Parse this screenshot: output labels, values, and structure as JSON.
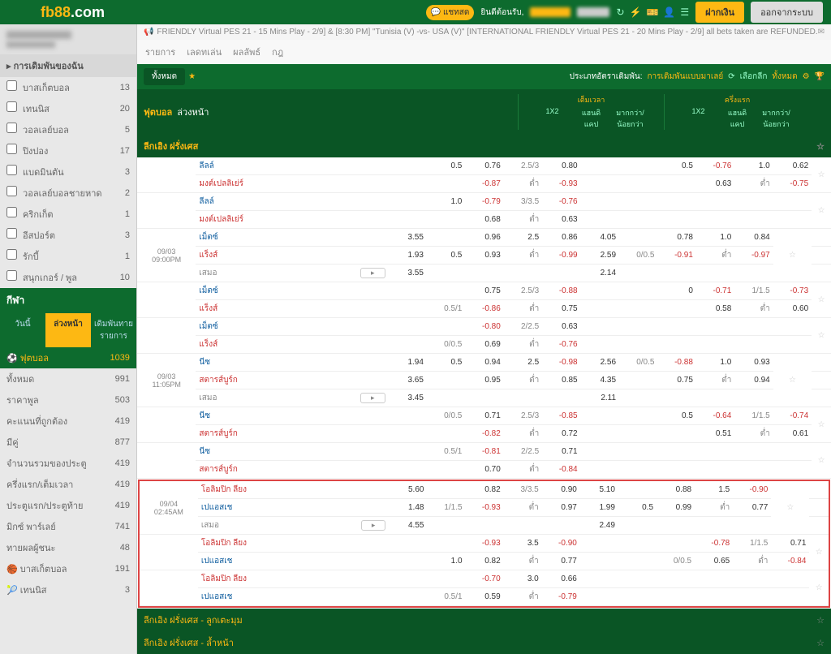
{
  "header": {
    "logo_main": "fb88",
    "logo_ext": ".com",
    "chat_label": "แชทสด",
    "welcome": "ยินดีต้อนรับ,",
    "deposit": "ฝากเงิน",
    "logout": "ออกจากระบบ"
  },
  "ticker": "FRIENDLY Virtual PES 21 - 15 Mins Play - 2/9] & [8:30 PM] \"Tunisia (V) -vs- USA (V)\" [INTERNATIONAL FRIENDLY Virtual PES 21 - 20 Mins Play - 2/9] all bets taken are REFUNDED.",
  "content_tabs": [
    "รายการ",
    "เลดทเล่น",
    "ผลลัพธ์",
    "กฎ"
  ],
  "sidebar": {
    "section_mybets": "การเดิมพันของฉัน",
    "mybets": [
      {
        "label": "บาสเก็ตบอล",
        "count": "13"
      },
      {
        "label": "เทนนิส",
        "count": "20"
      },
      {
        "label": "วอลเลย์บอล",
        "count": "5"
      },
      {
        "label": "ปิงปอง",
        "count": "17"
      },
      {
        "label": "แบดมินตัน",
        "count": "3"
      },
      {
        "label": "วอลเลย์บอลชายหาด",
        "count": "2"
      },
      {
        "label": "คริกเก็ต",
        "count": "1"
      },
      {
        "label": "อีสปอร์ต",
        "count": "3"
      },
      {
        "label": "รักบี้",
        "count": "1"
      },
      {
        "label": "สนุกเกอร์ / พูล",
        "count": "10"
      }
    ],
    "sport_header": "กีฬา",
    "sport_tabs": [
      "วันนี้",
      "ล่วงหน้า",
      "เดิมพันทาย\nรายการ"
    ],
    "sports": [
      {
        "label": "ฟุตบอล",
        "count": "1039",
        "icon": "⚽",
        "active": true
      },
      {
        "label": "ทั้งหมด",
        "count": "991"
      },
      {
        "label": "ราคาพูล",
        "count": "503"
      },
      {
        "label": "คะแนนที่ถูกต้อง",
        "count": "419"
      },
      {
        "label": "มีคู่",
        "count": "877"
      },
      {
        "label": "จำนวนรวมของประตู",
        "count": "419"
      },
      {
        "label": "ครึ่งแรก/เต็มเวลา",
        "count": "419"
      },
      {
        "label": "ประตูแรก/ประตูท้าย",
        "count": "419"
      },
      {
        "label": "มิกซ์ พาร์เลย์",
        "count": "741"
      },
      {
        "label": "ทายผลผู้ชนะ",
        "count": "48"
      },
      {
        "label": "บาสเก็ตบอล",
        "count": "191",
        "icon": "🏀"
      },
      {
        "label": "เทนนิส",
        "count": "3",
        "icon": "🎾"
      }
    ]
  },
  "filter": {
    "all": "ทั้งหมด",
    "label": "ประเภทอัตราเดิมพัน:",
    "type": "การเดิมพันแบบมาเลย์",
    "select": "เลือกลีก",
    "all2": "ทั้งหมด"
  },
  "title": {
    "main": "ฟุตบอล",
    "sub": "ล่วงหน้า",
    "fulltime": "เต็มเวลา",
    "firsthalf": "ครึ่งแรก",
    "cols": [
      "1X2",
      "แฮนดิแคป",
      "มากกว่า/น้อยกว่า",
      "1X2",
      "แฮนดิแคป",
      "มากกว่า/น้อยกว่า"
    ]
  },
  "league": "ลีกเอิง ฝรั่งเศส",
  "league_sub1": "ลีกเอิง ฝรั่งเศส - ลูกเตะมุม",
  "league_sub2": "ลีกเอิง ฝรั่งเศส - ล้ำหน้า",
  "matches": [
    {
      "rows": [
        {
          "team": "ลีลล์",
          "cls": "team",
          "o": [
            "",
            "0.5",
            "0.76",
            "2.5/3",
            "0.80",
            "",
            "",
            "0.5",
            "-0.76",
            "1.0",
            "0.62"
          ]
        },
        {
          "team": "มงต์เปลลิเย่ร์",
          "cls": "team away",
          "o": [
            "",
            "",
            "-0.87",
            "ต่ำ",
            "-0.93",
            "",
            "",
            "",
            "0.63",
            "ต่ำ",
            "-0.75"
          ]
        }
      ]
    },
    {
      "rows": [
        {
          "team": "ลีลล์",
          "cls": "team",
          "o": [
            "",
            "1.0",
            "-0.79",
            "3/3.5",
            "-0.76",
            "",
            "",
            "",
            "",
            "",
            ""
          ]
        },
        {
          "team": "มงต์เปลลิเย่ร์",
          "cls": "team away",
          "o": [
            "",
            "",
            "0.68",
            "ต่ำ",
            "0.63",
            "",
            "",
            "",
            "",
            "",
            ""
          ]
        }
      ]
    },
    {
      "date": "09/03",
      "time": "09:00PM",
      "rows": [
        {
          "team": "เม็ตซ์",
          "cls": "team",
          "o": [
            "3.55",
            "",
            "0.96",
            "2.5",
            "0.86",
            "4.05",
            "",
            "0.78",
            "1.0",
            "0.84"
          ]
        },
        {
          "team": "แร็งส์",
          "cls": "team away",
          "o": [
            "1.93",
            "0.5",
            "0.93",
            "ต่ำ",
            "-0.99",
            "2.59",
            "0/0.5",
            "-0.91",
            "ต่ำ",
            "-0.97"
          ]
        },
        {
          "team": "เสมอ",
          "cls": "team draw",
          "more": true,
          "o": [
            "3.55",
            "",
            "",
            "",
            "",
            "2.14",
            "",
            "",
            "",
            ""
          ]
        }
      ]
    },
    {
      "rows": [
        {
          "team": "เม็ตซ์",
          "cls": "team",
          "o": [
            "",
            "",
            "0.75",
            "2.5/3",
            "-0.88",
            "",
            "",
            "0",
            "-0.71",
            "1/1.5",
            "-0.73"
          ]
        },
        {
          "team": "แร็งส์",
          "cls": "team away",
          "o": [
            "",
            "0.5/1",
            "-0.86",
            "ต่ำ",
            "0.75",
            "",
            "",
            "",
            "0.58",
            "ต่ำ",
            "0.60"
          ]
        }
      ]
    },
    {
      "rows": [
        {
          "team": "เม็ตซ์",
          "cls": "team",
          "o": [
            "",
            "",
            "-0.80",
            "2/2.5",
            "0.63",
            "",
            "",
            "",
            "",
            "",
            ""
          ]
        },
        {
          "team": "แร็งส์",
          "cls": "team away",
          "o": [
            "",
            "0/0.5",
            "0.69",
            "ต่ำ",
            "-0.76",
            "",
            "",
            "",
            "",
            "",
            ""
          ]
        }
      ]
    },
    {
      "date": "09/03",
      "time": "11:05PM",
      "rows": [
        {
          "team": "นีซ",
          "cls": "team",
          "o": [
            "1.94",
            "0.5",
            "0.94",
            "2.5",
            "-0.98",
            "2.56",
            "0/0.5",
            "-0.88",
            "1.0",
            "0.93"
          ]
        },
        {
          "team": "สตารส์บูร์ก",
          "cls": "team away",
          "o": [
            "3.65",
            "",
            "0.95",
            "ต่ำ",
            "0.85",
            "4.35",
            "",
            "0.75",
            "ต่ำ",
            "0.94"
          ]
        },
        {
          "team": "เสมอ",
          "cls": "team draw",
          "more": true,
          "o": [
            "3.45",
            "",
            "",
            "",
            "",
            "2.11",
            "",
            "",
            "",
            ""
          ]
        }
      ]
    },
    {
      "rows": [
        {
          "team": "นีซ",
          "cls": "team",
          "o": [
            "",
            "0/0.5",
            "0.71",
            "2.5/3",
            "-0.85",
            "",
            "",
            "0.5",
            "-0.64",
            "1/1.5",
            "-0.74"
          ]
        },
        {
          "team": "สตารส์บูร์ก",
          "cls": "team away",
          "o": [
            "",
            "",
            "-0.82",
            "ต่ำ",
            "0.72",
            "",
            "",
            "",
            "0.51",
            "ต่ำ",
            "0.61"
          ]
        }
      ]
    },
    {
      "rows": [
        {
          "team": "นีซ",
          "cls": "team",
          "o": [
            "",
            "0.5/1",
            "-0.81",
            "2/2.5",
            "0.71",
            "",
            "",
            "",
            "",
            "",
            ""
          ]
        },
        {
          "team": "สตารส์บูร์ก",
          "cls": "team away",
          "o": [
            "",
            "",
            "0.70",
            "ต่ำ",
            "-0.84",
            "",
            "",
            "",
            "",
            "",
            ""
          ]
        }
      ]
    }
  ],
  "highlighted": [
    {
      "date": "09/04",
      "time": "02:45AM",
      "rows": [
        {
          "team": "โอลิมปิก ลียง",
          "cls": "team away",
          "o": [
            "5.60",
            "",
            "0.82",
            "3/3.5",
            "0.90",
            "5.10",
            "",
            "0.88",
            "1.5",
            "-0.90"
          ]
        },
        {
          "team": "เปแอสเช",
          "cls": "team",
          "o": [
            "1.48",
            "1/1.5",
            "-0.93",
            "ต่ำ",
            "0.97",
            "1.99",
            "0.5",
            "0.99",
            "ต่ำ",
            "0.77"
          ]
        },
        {
          "team": "เสมอ",
          "cls": "team draw",
          "more": true,
          "o": [
            "4.55",
            "",
            "",
            "",
            "",
            "2.49",
            "",
            "",
            "",
            ""
          ]
        }
      ]
    },
    {
      "rows": [
        {
          "team": "โอลิมปิก ลียง",
          "cls": "team away",
          "o": [
            "",
            "",
            "-0.93",
            "3.5",
            "-0.90",
            "",
            "",
            "",
            "-0.78",
            "1/1.5",
            "0.71"
          ]
        },
        {
          "team": "เปแอสเช",
          "cls": "team",
          "o": [
            "",
            "1.0",
            "0.82",
            "ต่ำ",
            "0.77",
            "",
            "",
            "0/0.5",
            "0.65",
            "ต่ำ",
            "-0.84"
          ]
        }
      ]
    },
    {
      "rows": [
        {
          "team": "โอลิมปิก ลียง",
          "cls": "team away",
          "o": [
            "",
            "",
            "-0.70",
            "3.0",
            "0.66",
            "",
            "",
            "",
            "",
            "",
            ""
          ]
        },
        {
          "team": "เปแอสเช",
          "cls": "team",
          "o": [
            "",
            "0.5/1",
            "0.59",
            "ต่ำ",
            "-0.79",
            "",
            "",
            "",
            "",
            "",
            ""
          ]
        }
      ]
    }
  ]
}
